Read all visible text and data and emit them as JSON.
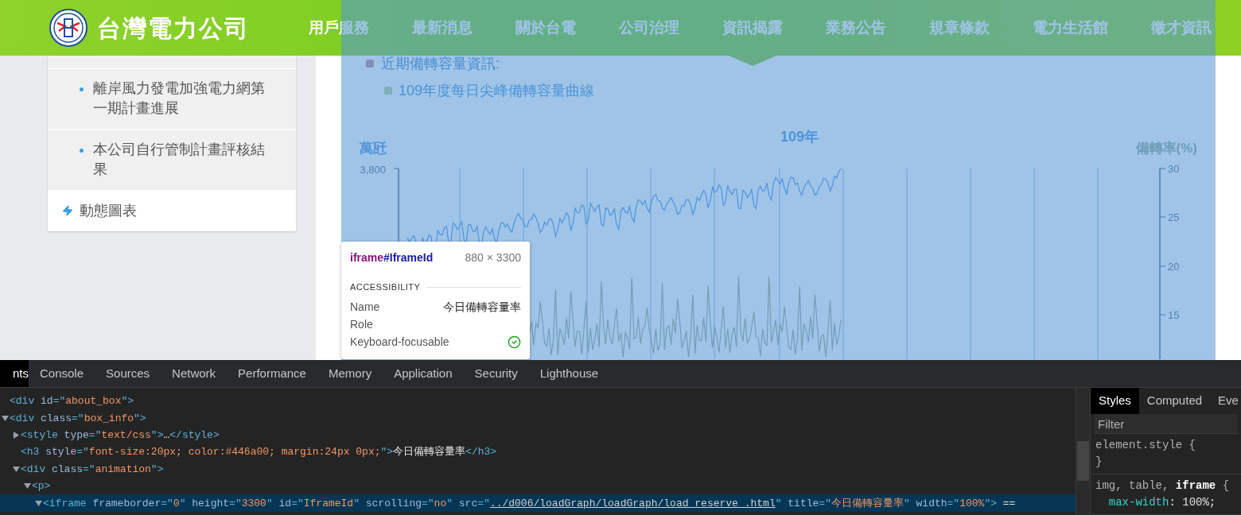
{
  "header": {
    "logo_text": "台灣電力公司",
    "nav": [
      {
        "label": "用戶服務",
        "selected": false
      },
      {
        "label": "最新消息",
        "selected": false
      },
      {
        "label": "關於台電",
        "selected": false
      },
      {
        "label": "公司治理",
        "selected": false
      },
      {
        "label": "資訊揭露",
        "selected": true
      },
      {
        "label": "業務公告",
        "selected": false
      },
      {
        "label": "規章條款",
        "selected": false
      },
      {
        "label": "電力生活館",
        "selected": false
      },
      {
        "label": "徵才資訊",
        "selected": false
      }
    ]
  },
  "sidebar": {
    "items": [
      {
        "kind": "bullet",
        "label": "離岸風力發電加強電力網第一期計畫進展"
      },
      {
        "kind": "bullet",
        "label": "本公司自行管制計畫評核結果"
      },
      {
        "kind": "section",
        "label": "動態圖表"
      }
    ]
  },
  "content": {
    "list": [
      {
        "label": "近期備轉容量資訊:",
        "children": [
          {
            "label": "109年度每日尖峰備轉容量曲線"
          }
        ]
      }
    ],
    "chart": {
      "title": "109年",
      "left_axis_label": "萬瓩",
      "right_axis_label": "備轉率(%)",
      "left_ticks": [
        "3,800"
      ],
      "right_ticks": [
        "30",
        "25",
        "20",
        "15"
      ]
    }
  },
  "inspect_tooltip": {
    "tag": "iframe",
    "id": "#IframeId",
    "size": "880 × 3300",
    "section": "ACCESSIBILITY",
    "rows": [
      {
        "kind": "text",
        "label": "Name",
        "value": "今日備轉容量率"
      },
      {
        "kind": "text",
        "label": "Role"
      },
      {
        "kind": "check",
        "label": "Keyboard-focusable",
        "checked": true
      }
    ]
  },
  "devtools": {
    "tabs": [
      {
        "label": "nts",
        "selected": true
      },
      {
        "label": "Console",
        "selected": false
      },
      {
        "label": "Sources",
        "selected": false
      },
      {
        "label": "Network",
        "selected": false
      },
      {
        "label": "Performance",
        "selected": false
      },
      {
        "label": "Memory",
        "selected": false
      },
      {
        "label": "Application",
        "selected": false
      },
      {
        "label": "Security",
        "selected": false
      },
      {
        "label": "Lighthouse",
        "selected": false
      }
    ],
    "dom_tree": [
      {
        "selected": false,
        "tokens": [
          {
            "kind": "tag",
            "text": "<div"
          },
          {
            "kind": "attr",
            "text": " id"
          },
          {
            "kind": "tag",
            "text": "=\""
          },
          {
            "kind": "value",
            "text": "about_box"
          },
          {
            "kind": "tag",
            "text": "\">"
          }
        ]
      },
      {
        "expanded": true,
        "selected": false,
        "tokens": [
          {
            "kind": "tag",
            "text": "<div"
          },
          {
            "kind": "attr",
            "text": " class"
          },
          {
            "kind": "tag",
            "text": "=\""
          },
          {
            "kind": "value",
            "text": "box_info"
          },
          {
            "kind": "tag",
            "text": "\">"
          }
        ],
        "children": [
          {
            "expanded": false,
            "selected": false,
            "tokens": [
              {
                "kind": "tag",
                "text": "<style"
              },
              {
                "kind": "attr",
                "text": " type"
              },
              {
                "kind": "tag",
                "text": "=\""
              },
              {
                "kind": "value",
                "text": "text/css"
              },
              {
                "kind": "tag",
                "text": "\">"
              },
              {
                "kind": "text",
                "text": "…"
              },
              {
                "kind": "tag",
                "text": "</style>"
              }
            ]
          },
          {
            "selected": false,
            "tokens": [
              {
                "kind": "tag",
                "text": "<h3"
              },
              {
                "kind": "attr",
                "text": " style"
              },
              {
                "kind": "tag",
                "text": "=\""
              },
              {
                "kind": "value",
                "text": "font-size:20px; color:#446a00; margin:24px 0px;"
              },
              {
                "kind": "tag",
                "text": "\">"
              },
              {
                "kind": "text",
                "text": "今日備轉容量率"
              },
              {
                "kind": "tag",
                "text": "</h3>"
              }
            ]
          },
          {
            "expanded": true,
            "selected": false,
            "tokens": [
              {
                "kind": "tag",
                "text": "<div"
              },
              {
                "kind": "attr",
                "text": " class"
              },
              {
                "kind": "tag",
                "text": "=\""
              },
              {
                "kind": "value",
                "text": "animation"
              },
              {
                "kind": "tag",
                "text": "\">"
              }
            ],
            "children": [
              {
                "expanded": true,
                "selected": false,
                "tokens": [
                  {
                    "kind": "tag",
                    "text": "<p>"
                  }
                ],
                "children": [
                  {
                    "expanded": true,
                    "selected": true,
                    "tokens": [
                      {
                        "kind": "tag",
                        "text": "<iframe"
                      },
                      {
                        "kind": "attr",
                        "text": " frameborder"
                      },
                      {
                        "kind": "tag",
                        "text": "=\""
                      },
                      {
                        "kind": "value",
                        "text": "0"
                      },
                      {
                        "kind": "tag",
                        "text": "\""
                      },
                      {
                        "kind": "attr",
                        "text": " height"
                      },
                      {
                        "kind": "tag",
                        "text": "=\""
                      },
                      {
                        "kind": "value",
                        "text": "3300"
                      },
                      {
                        "kind": "tag",
                        "text": "\""
                      },
                      {
                        "kind": "attr",
                        "text": " id"
                      },
                      {
                        "kind": "tag",
                        "text": "=\""
                      },
                      {
                        "kind": "value",
                        "text": "IframeId"
                      },
                      {
                        "kind": "tag",
                        "text": "\""
                      },
                      {
                        "kind": "attr",
                        "text": " scrolling"
                      },
                      {
                        "kind": "tag",
                        "text": "=\""
                      },
                      {
                        "kind": "value",
                        "text": "no"
                      },
                      {
                        "kind": "tag",
                        "text": "\""
                      },
                      {
                        "kind": "attr",
                        "text": " src"
                      },
                      {
                        "kind": "tag",
                        "text": "=\""
                      },
                      {
                        "kind": "link",
                        "text": "../d006/loadGraph/loadGraph/load_reserve_.html"
                      },
                      {
                        "kind": "tag",
                        "text": "\""
                      },
                      {
                        "kind": "attr",
                        "text": " title"
                      },
                      {
                        "kind": "tag",
                        "text": "=\""
                      },
                      {
                        "kind": "value",
                        "text": "今日備轉容量率"
                      },
                      {
                        "kind": "tag",
                        "text": "\""
                      },
                      {
                        "kind": "attr",
                        "text": " width"
                      },
                      {
                        "kind": "tag",
                        "text": "=\""
                      },
                      {
                        "kind": "value",
                        "text": "100%"
                      },
                      {
                        "kind": "tag",
                        "text": "\">"
                      },
                      {
                        "kind": "text",
                        "text": " =="
                      }
                    ]
                  }
                ]
              }
            ]
          }
        ]
      }
    ],
    "styles_tabs": [
      {
        "label": "Styles",
        "selected": true
      },
      {
        "label": "Computed",
        "selected": false
      },
      {
        "label": "Eve",
        "selected": false
      }
    ],
    "filter_placeholder": "Filter",
    "rules": [
      {
        "lines": [
          [
            {
              "kind": "selector",
              "text": "element.style {"
            }
          ],
          [
            {
              "kind": "selector",
              "text": "}"
            }
          ]
        ]
      },
      {
        "lines": [
          [
            {
              "kind": "selector",
              "text": "img, table, "
            },
            {
              "kind": "match",
              "text": "iframe"
            },
            {
              "kind": "selector",
              "text": " {"
            }
          ],
          [
            {
              "kind": "property",
              "text": "  max-width"
            },
            {
              "kind": "plain",
              "text": ": 100%;"
            }
          ]
        ]
      }
    ]
  }
}
